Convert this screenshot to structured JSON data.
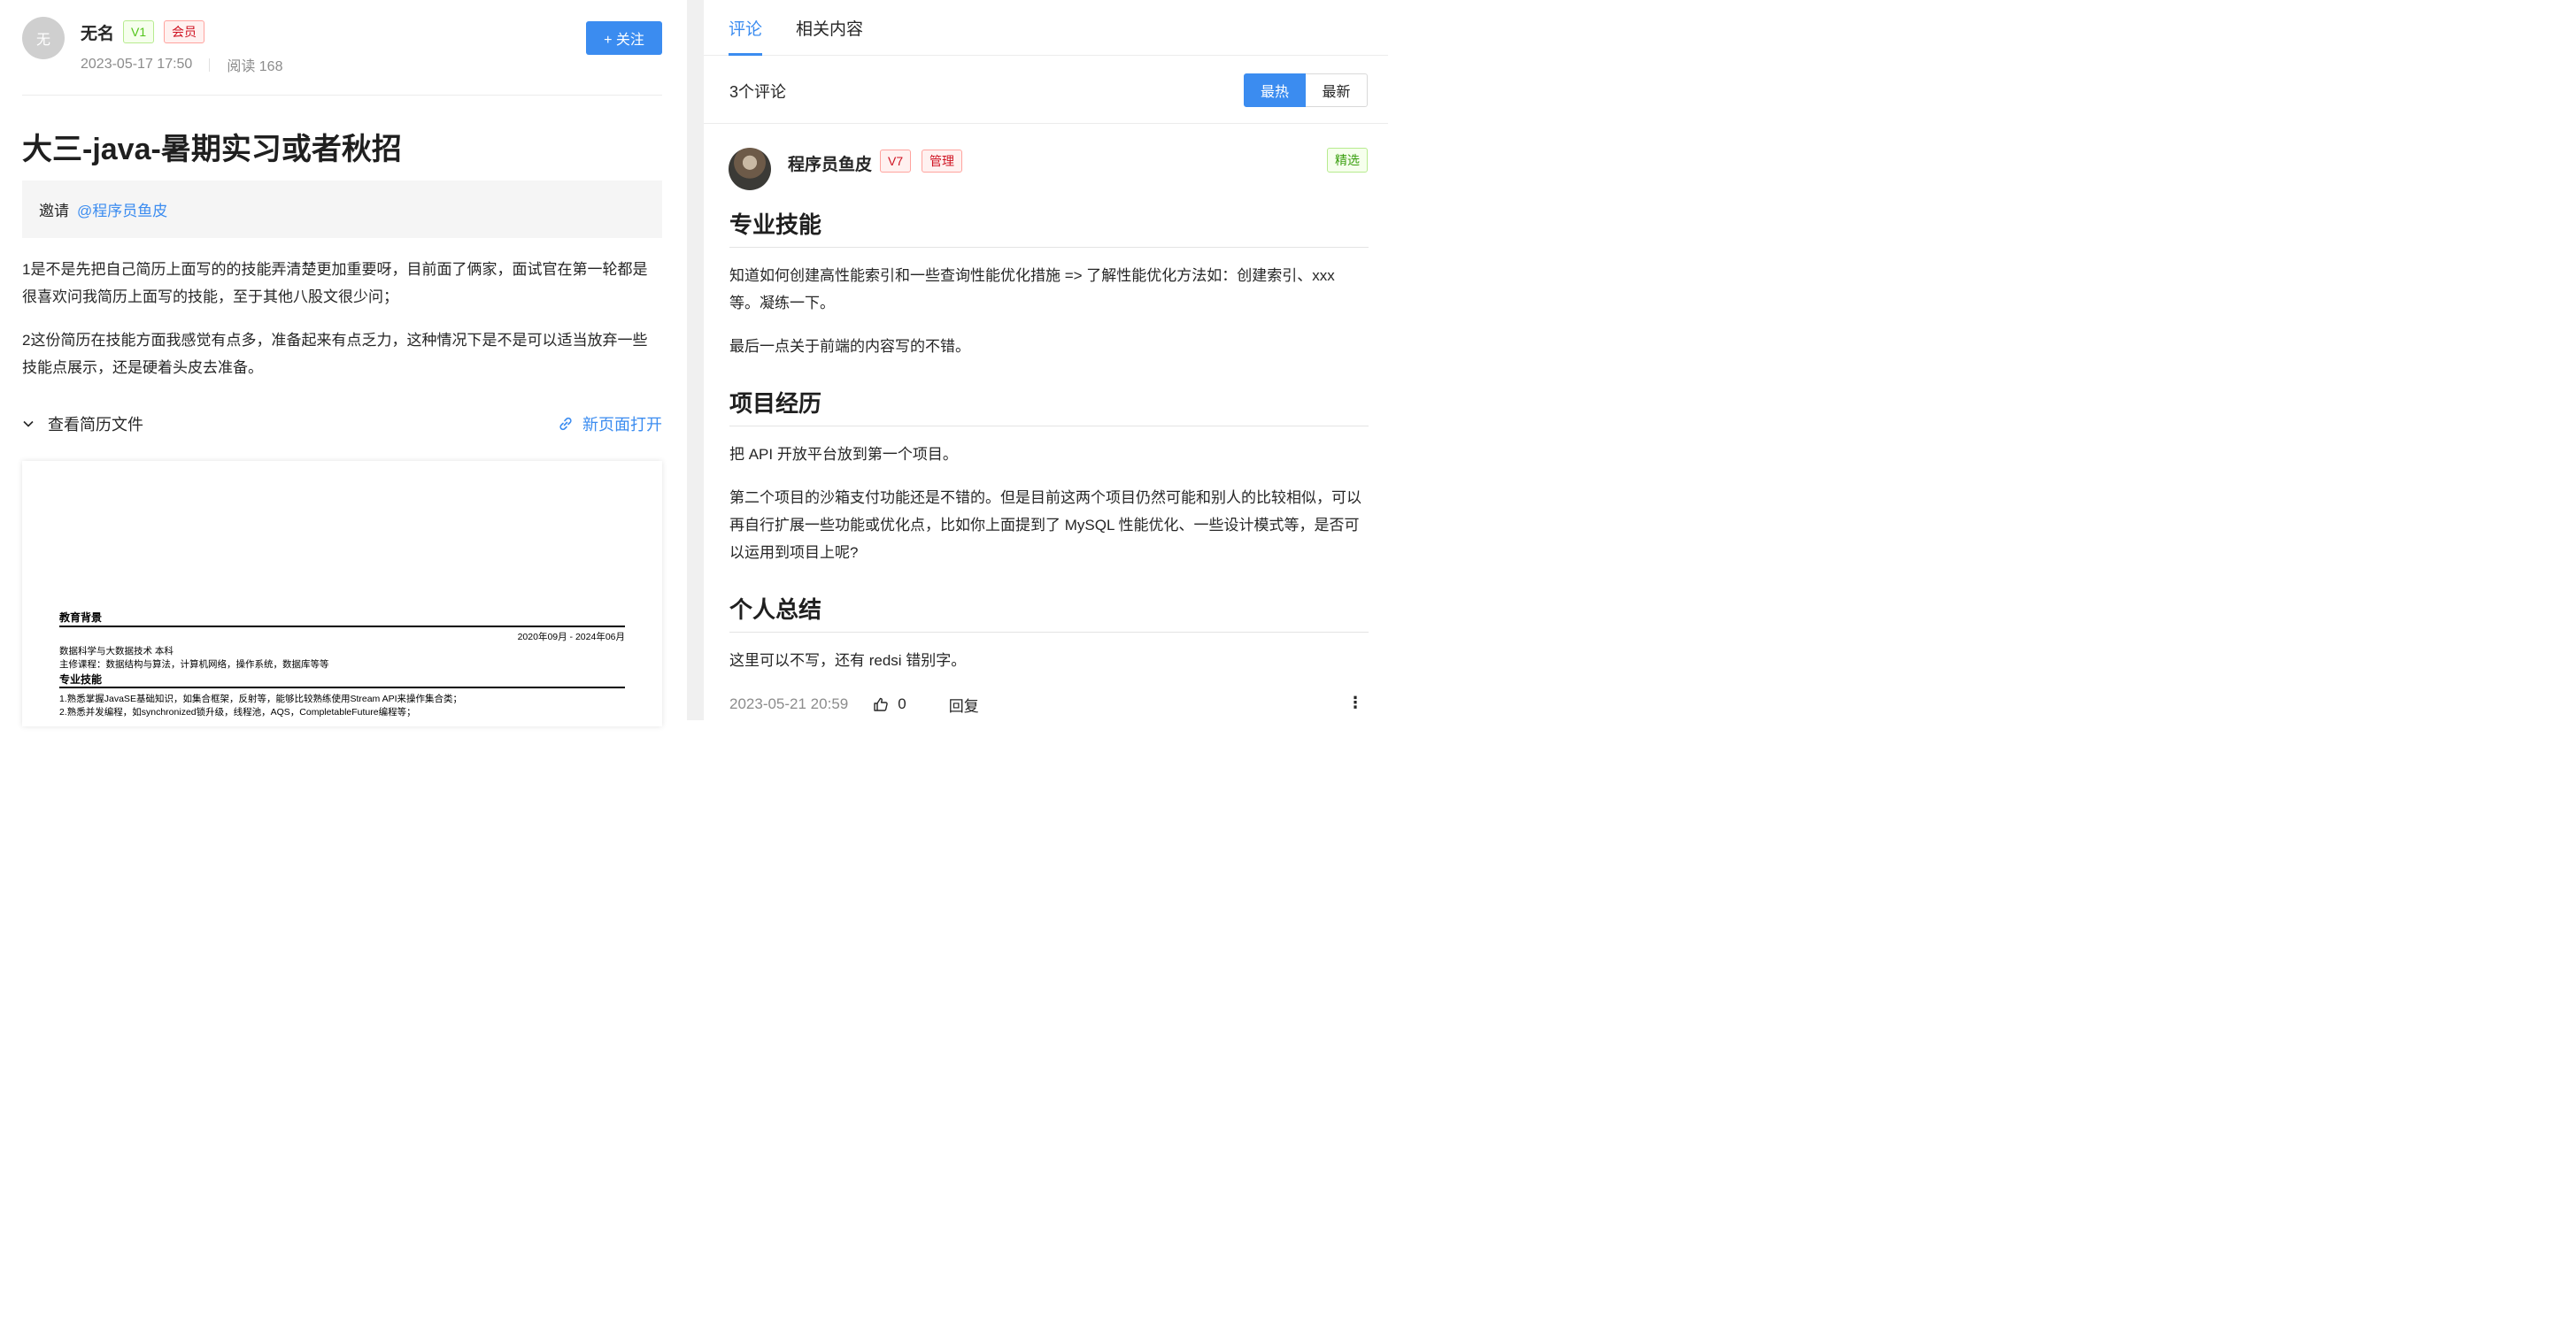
{
  "post": {
    "author": {
      "avatar_text": "无",
      "name": "无名",
      "level_tag": "V1",
      "member_tag": "会员"
    },
    "date": "2023-05-17 17:50",
    "reads": "阅读 168",
    "follow_label": "+ 关注",
    "title": "大三-java-暑期实习或者秋招",
    "invite_label": "邀请",
    "invite_mention": "@程序员鱼皮",
    "paragraphs": [
      "1是不是先把自己简历上面写的的技能弄清楚更加重要呀，目前面了俩家，面试官在第一轮都是很喜欢问我简历上面写的技能，至于其他八股文很少问；",
      "2这份简历在技能方面我感觉有点多，准备起来有点乏力，这种情况下是不是可以适当放弃一些技能点展示，还是硬着头皮去准备。"
    ],
    "resume_toggle": "查看简历文件",
    "new_page_link": "新页面打开",
    "resume": {
      "edu_heading": "教育背景",
      "edu_date": "2020年09月 - 2024年06月",
      "edu_major": "数据科学与大数据技术 本科",
      "edu_courses": "主修课程：数据结构与算法，计算机网络，操作系统，数据库等等",
      "skills_heading": "专业技能",
      "skill_1": "1.熟悉掌握JavaSE基础知识，如集合框架，反射等，能够比较熟练使用Stream API来操作集合类；",
      "skill_2": "2.熟悉并发编程，如synchronized锁升级，线程池，AQS，CompletableFuture编程等；"
    }
  },
  "comments_panel": {
    "tabs": [
      {
        "label": "评论"
      },
      {
        "label": "相关内容"
      }
    ],
    "count_text": "3个评论",
    "sort": {
      "hot": "最热",
      "new": "最新"
    },
    "comment": {
      "author": "程序员鱼皮",
      "level_tag": "V7",
      "role_tag": "管理",
      "featured": "精选",
      "sections": [
        {
          "heading": "专业技能",
          "paras": [
            "知道如何创建高性能索引和一些查询性能优化措施 => 了解性能优化方法如：创建索引、xxx 等。凝练一下。",
            "最后一点关于前端的内容写的不错。"
          ]
        },
        {
          "heading": "项目经历",
          "paras": [
            "把 API 开放平台放到第一个项目。",
            "第二个项目的沙箱支付功能还是不错的。但是目前这两个项目仍然可能和别人的比较相似，可以再自行扩展一些功能或优化点，比如你上面提到了 MySQL 性能优化、一些设计模式等，是否可以运用到项目上呢?"
          ]
        },
        {
          "heading": "个人总结",
          "paras": [
            "这里可以不写，还有 redsi 错别字。"
          ]
        }
      ],
      "date": "2023-05-21 20:59",
      "likes": "0",
      "reply_label": "回复",
      "more_label": "⋮"
    }
  },
  "colors": {
    "accent": "#3b8cf0",
    "tag_green": "#52c41a",
    "tag_red": "#cf1322"
  }
}
